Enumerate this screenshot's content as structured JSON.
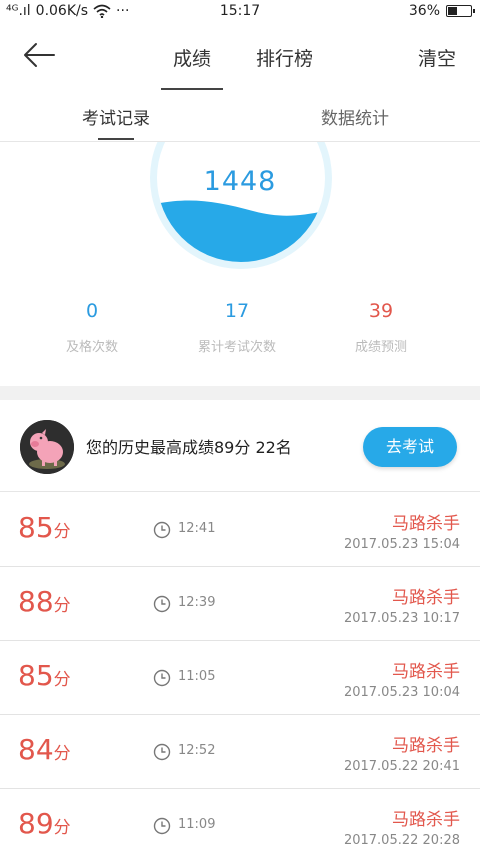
{
  "status_bar": {
    "signal": "⁴ᴳ.ıl",
    "speed": "0.06K/s",
    "dots": "···",
    "time": "15:17",
    "battery_text": "36%",
    "battery_level": 0.36
  },
  "nav": {
    "tab_scores": "成绩",
    "tab_ranking": "排行榜",
    "clear": "清空"
  },
  "subnav": {
    "exam_records": "考试记录",
    "data_stats": "数据统计"
  },
  "gauge": {
    "score": "1448",
    "fill_color": "#27a9e8",
    "ring_color": "#e3f5fc"
  },
  "stats": [
    {
      "value": "0",
      "label": "及格次数",
      "color": "#2b9be0"
    },
    {
      "value": "17",
      "label": "累计考试次数",
      "color": "#2b9be0"
    },
    {
      "value": "39",
      "label": "成绩预测",
      "color": "#e2574c"
    }
  ],
  "best": {
    "text": "您的历史最高成绩89分  22名",
    "button": "去考试"
  },
  "records": [
    {
      "score": "85",
      "unit": "分",
      "duration": "12:41",
      "title": "马路杀手",
      "date": "2017.05.23  15:04"
    },
    {
      "score": "88",
      "unit": "分",
      "duration": "12:39",
      "title": "马路杀手",
      "date": "2017.05.23  10:17"
    },
    {
      "score": "85",
      "unit": "分",
      "duration": "11:05",
      "title": "马路杀手",
      "date": "2017.05.23  10:04"
    },
    {
      "score": "84",
      "unit": "分",
      "duration": "12:52",
      "title": "马路杀手",
      "date": "2017.05.22  20:41"
    },
    {
      "score": "89",
      "unit": "分",
      "duration": "11:09",
      "title": "马路杀手",
      "date": "2017.05.22  20:28"
    }
  ]
}
